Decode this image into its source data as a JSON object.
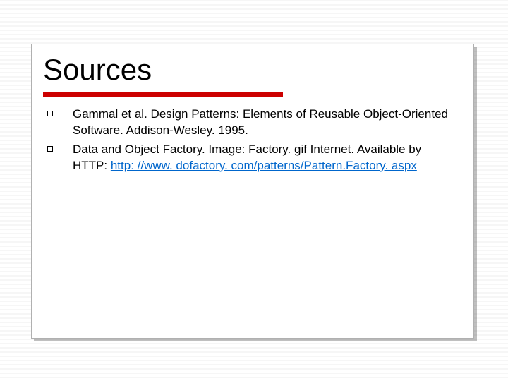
{
  "title": "Sources",
  "items": [
    {
      "prefix": "Gammal et al. ",
      "underlined": "Design Patterns: Elements of Reusable Object-Oriented Software. ",
      "suffix": " Addison-Wesley. 1995."
    },
    {
      "prefix": "Data and Object Factory. Image: Factory. gif Internet. Available by HTTP: ",
      "link": "http: //www. dofactory. com/patterns/Pattern.Factory. aspx"
    }
  ]
}
